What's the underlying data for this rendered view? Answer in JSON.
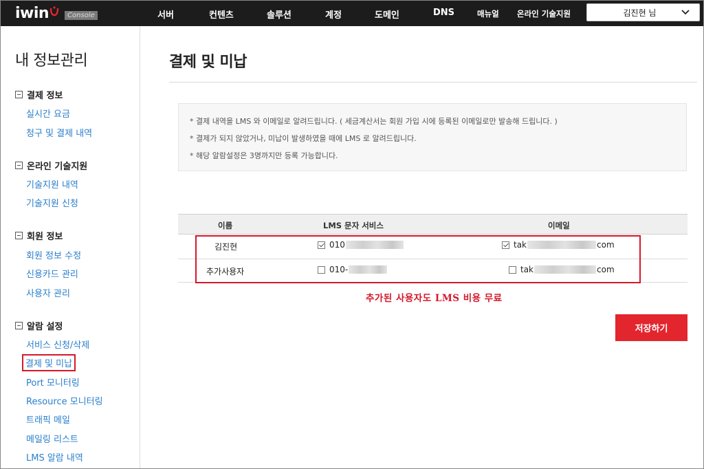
{
  "topbar": {
    "logo": "iwin",
    "console_tag": "Console",
    "nav": [
      "서버",
      "컨텐츠",
      "솔루션",
      "계정",
      "도메인",
      "DNS",
      "매뉴얼",
      "온라인 기술지원"
    ],
    "user_name": "김진현 님"
  },
  "sidebar": {
    "title": "내 정보관리",
    "groups": [
      {
        "title": "결제 정보",
        "items": [
          "실시간 요금",
          "청구 및 결제 내역"
        ]
      },
      {
        "title": "온라인 기술지원",
        "items": [
          "기술지원 내역",
          "기술지원 신청"
        ]
      },
      {
        "title": "회원 정보",
        "items": [
          "회원 정보 수정",
          "신용카드 관리",
          "사용자 관리"
        ]
      },
      {
        "title": "알람 설정",
        "items": [
          "서비스 신청/삭제",
          "결제 및 미납",
          "Port 모니터링",
          "Resource 모니터링",
          "트래픽 메일",
          "메일링 리스트",
          "LMS 알람 내역"
        ]
      }
    ]
  },
  "main": {
    "title": "결제 및 미납",
    "notices": [
      "* 결제 내역을 LMS 와 이메일로 알려드립니다. ( 세금계산서는 회원 가입 시에 등록된 이메일로만 발송해 드립니다. )",
      "* 결제가 되지 않았거나, 미납이 발생하였을 때에 LMS 로 알려드립니다.",
      "* 해당 알람설정은 3명까지만 등록 가능합니다."
    ],
    "table": {
      "headers": [
        "이름",
        "LMS 문자 서비스",
        "이메일"
      ],
      "rows": [
        {
          "name": "김진현",
          "lms_checked": true,
          "lms": "010",
          "email_checked": true,
          "email_prefix": "tak",
          "email_suffix": "com"
        },
        {
          "name": "추가사용자",
          "lms_checked": false,
          "lms": "010-",
          "email_checked": false,
          "email_prefix": "tak",
          "email_suffix": "com"
        }
      ]
    },
    "annotation": "추가된 사용자도 LMS 비용 무료",
    "save_label": "저장하기"
  },
  "colors": {
    "accent_red": "#e3252e",
    "link_blue": "#2a7fcc",
    "topbar": "#1c1c1c"
  }
}
